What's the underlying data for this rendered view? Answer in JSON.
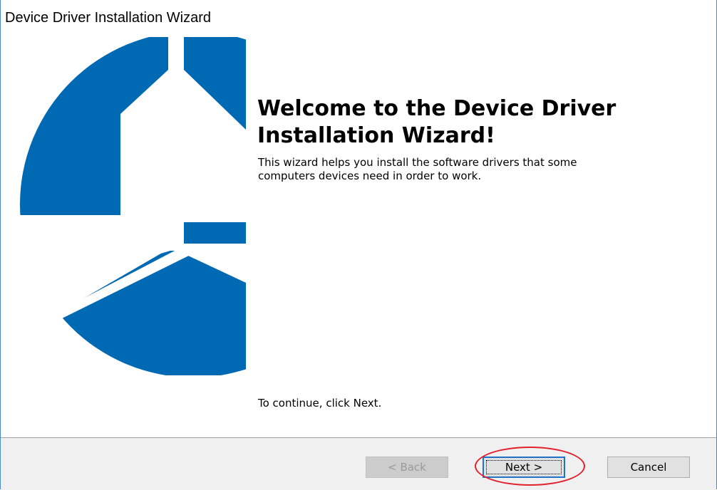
{
  "window": {
    "title": "Device Driver Installation Wizard"
  },
  "welcome": {
    "heading_line1": "Welcome to the Device Driver",
    "heading_line2": "Installation Wizard!",
    "description_line1": "This wizard helps you install the software drivers that some",
    "description_line2": "computers devices need in order to work.",
    "continue_text": "To continue, click Next."
  },
  "buttons": {
    "back": "< Back",
    "next": "Next >",
    "cancel": "Cancel"
  },
  "colors": {
    "logo_blue": "#0069b4",
    "highlight_ring": "#e0202a",
    "focus_border": "#1f73c8"
  },
  "icons": {
    "logo": "three-blade-driver-logo-icon"
  }
}
